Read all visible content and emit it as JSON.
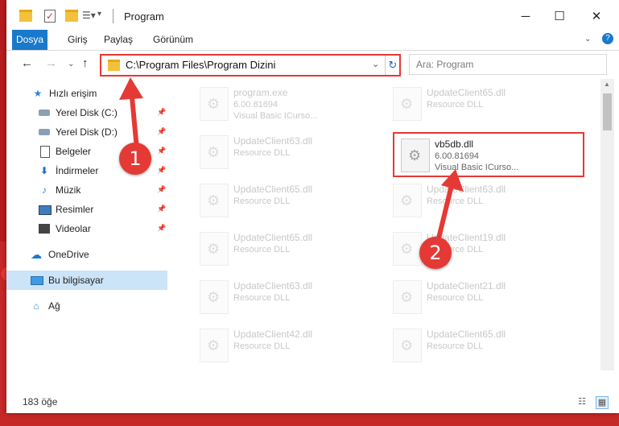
{
  "window": {
    "title": "Program",
    "minimize": "─",
    "maximize": "☐",
    "close": "✕"
  },
  "quick_access": {
    "properties": "☰▾",
    "customize": "▾"
  },
  "ribbon": {
    "tabs": [
      "Dosya",
      "Giriş",
      "Paylaş",
      "Görünüm"
    ],
    "expand": "⌄",
    "help": "?"
  },
  "nav": {
    "back": "←",
    "forward": "→",
    "recent": "⌄",
    "up": "↑",
    "address": "C:\\Program Files\\Program Dizini",
    "address_dropdown": "⌄",
    "refresh": "↻",
    "search_placeholder": "Ara: Program"
  },
  "sidebar": {
    "quick_access": "Hızlı erişim",
    "items": [
      {
        "label": "Yerel Disk (C:)",
        "icon": "drive-icon",
        "pinned": true
      },
      {
        "label": "Yerel Disk (D:)",
        "icon": "drive-icon",
        "pinned": true
      },
      {
        "label": "Belgeler",
        "icon": "document-icon",
        "pinned": true
      },
      {
        "label": "İndirmeler",
        "icon": "download-icon",
        "pinned": true
      },
      {
        "label": "Müzik",
        "icon": "music-icon",
        "pinned": true
      },
      {
        "label": "Resimler",
        "icon": "pictures-icon",
        "pinned": true
      },
      {
        "label": "Videolar",
        "icon": "video-icon",
        "pinned": true
      }
    ],
    "onedrive": "OneDrive",
    "this_pc": "Bu bilgisayar",
    "network": "Ağ",
    "pin_glyph": "📌"
  },
  "files": [
    {
      "name": "program.exe",
      "line1": "6.00.81694",
      "line2": "Visual Basic ICurso..."
    },
    {
      "name": "UpdateClient65.dll",
      "line1": "Resource DLL",
      "line2": ""
    },
    {
      "name": "UpdateClient63.dll",
      "line1": "Resource DLL",
      "line2": ""
    },
    {
      "name": "vb5db.dll",
      "line1": "6.00.81694",
      "line2": "Visual Basic ICurso..."
    },
    {
      "name": "UpdateClient65.dll",
      "line1": "Resource DLL",
      "line2": ""
    },
    {
      "name": "UpdateClient63.dll",
      "line1": "Resource DLL",
      "line2": ""
    },
    {
      "name": "UpdateClient65.dll",
      "line1": "Resource DLL",
      "line2": ""
    },
    {
      "name": "UpdateClient19.dll",
      "line1": "Resource DLL",
      "line2": ""
    },
    {
      "name": "UpdateClient63.dll",
      "line1": "Resource DLL",
      "line2": ""
    },
    {
      "name": "UpdateClient21.dll",
      "line1": "Resource DLL",
      "line2": ""
    },
    {
      "name": "UpdateClient42.dll",
      "line1": "Resource DLL",
      "line2": ""
    },
    {
      "name": "UpdateClient65.dll",
      "line1": "Resource DLL",
      "line2": ""
    }
  ],
  "status": {
    "count": "183 öğe",
    "details_view": "☷",
    "icons_view": "▦"
  },
  "callouts": {
    "one": "1",
    "two": "2"
  },
  "colors": {
    "accent": "#1979ca",
    "highlight": "#e53935",
    "selected": "#cce4f7"
  }
}
